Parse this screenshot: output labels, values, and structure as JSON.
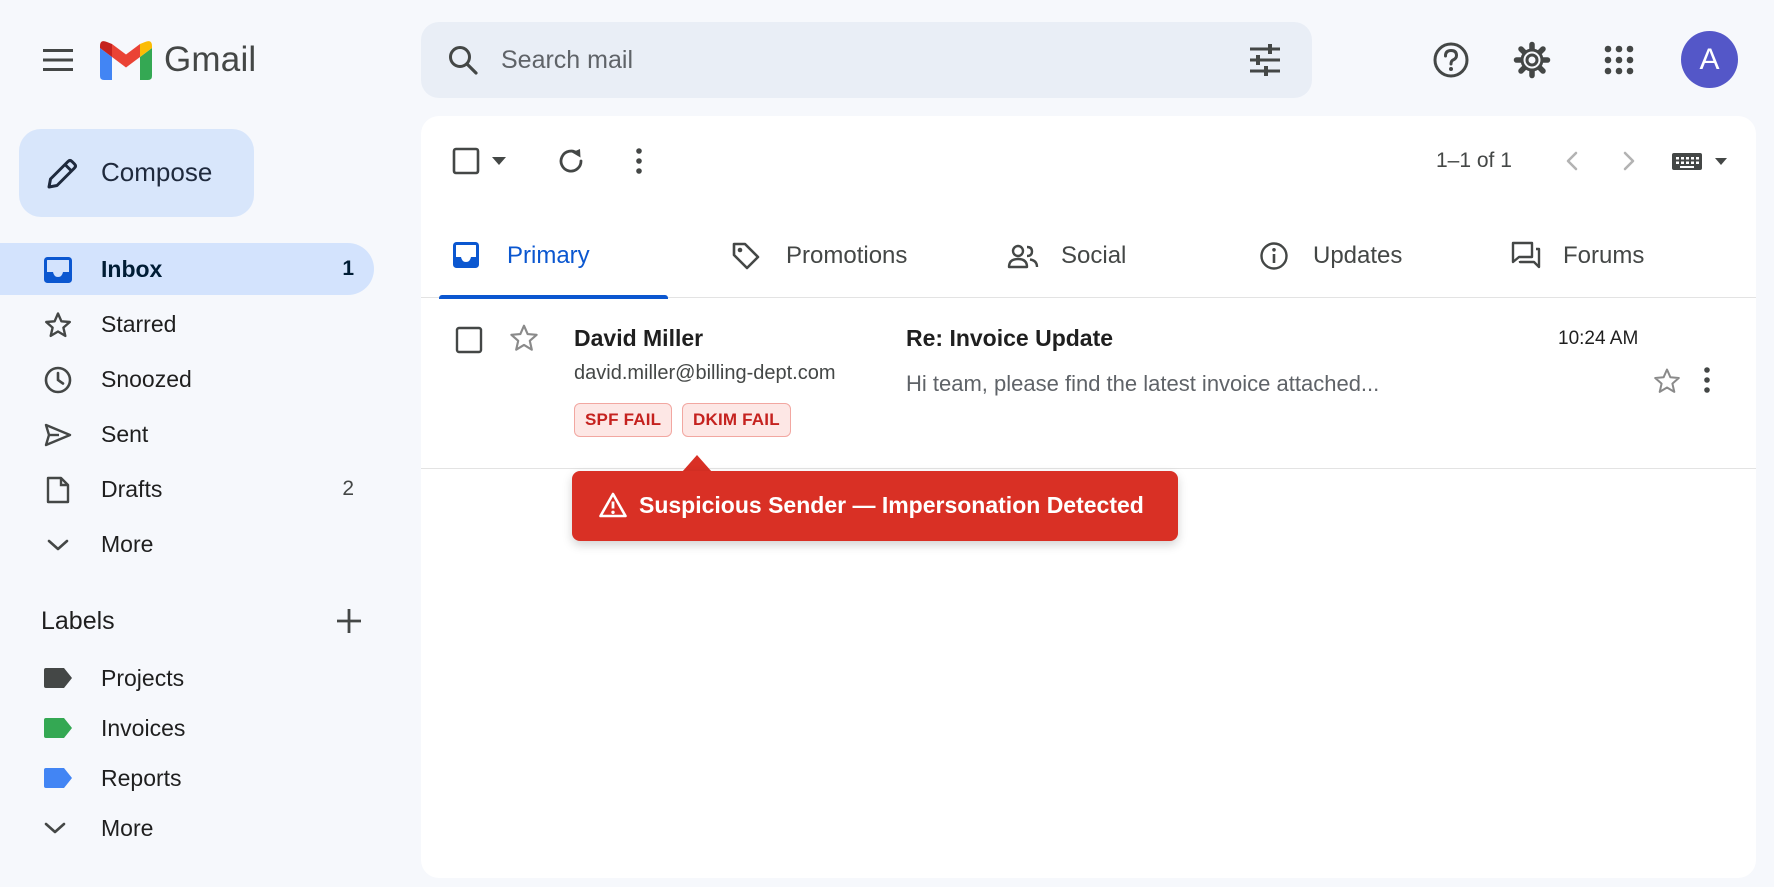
{
  "app": {
    "name": "Gmail",
    "accent_color": "#0b57d0",
    "warning_color": "#d93025"
  },
  "search": {
    "placeholder": "Search mail",
    "value": ""
  },
  "header": {
    "icons": [
      "menu-icon",
      "help-icon",
      "settings-icon",
      "apps-icon"
    ],
    "avatar_initial": "A",
    "avatar_color": "#5457c8"
  },
  "compose": {
    "label": "Compose"
  },
  "nav": {
    "items": [
      {
        "label": "Inbox",
        "count": "1",
        "icon": "inbox-icon",
        "active": true
      },
      {
        "label": "Starred",
        "count": "",
        "icon": "star-icon"
      },
      {
        "label": "Snoozed",
        "count": "",
        "icon": "clock-icon"
      },
      {
        "label": "Sent",
        "count": "",
        "icon": "send-icon"
      },
      {
        "label": "Drafts",
        "count": "2",
        "icon": "draft-icon"
      },
      {
        "label": "More",
        "count": "",
        "icon": "chevron-down-icon"
      }
    ]
  },
  "labels": {
    "title": "Labels",
    "items": [
      {
        "label": "Projects",
        "color": "#444746"
      },
      {
        "label": "Invoices",
        "color": "#34a853"
      },
      {
        "label": "Reports",
        "color": "#4285f4"
      }
    ],
    "more_label": "More"
  },
  "toolbar": {
    "page_info": "1–1 of 1"
  },
  "tabs": [
    {
      "label": "Primary",
      "icon": "inbox-tab-icon",
      "active": true
    },
    {
      "label": "Promotions",
      "icon": "tag-icon"
    },
    {
      "label": "Social",
      "icon": "people-icon"
    },
    {
      "label": "Updates",
      "icon": "info-icon"
    },
    {
      "label": "Forums",
      "icon": "forum-icon"
    }
  ],
  "emails": [
    {
      "sender": "David Miller",
      "sender_email": "david.miller@billing-dept.com",
      "subject": "Re: Invoice Update",
      "snippet": "Hi team, please find the latest invoice attached...",
      "time": "10:24 AM",
      "badges": [
        "SPF FAIL",
        "DKIM FAIL"
      ],
      "unread": true
    }
  ],
  "warning": {
    "text": "Suspicious Sender — Impersonation Detected"
  }
}
